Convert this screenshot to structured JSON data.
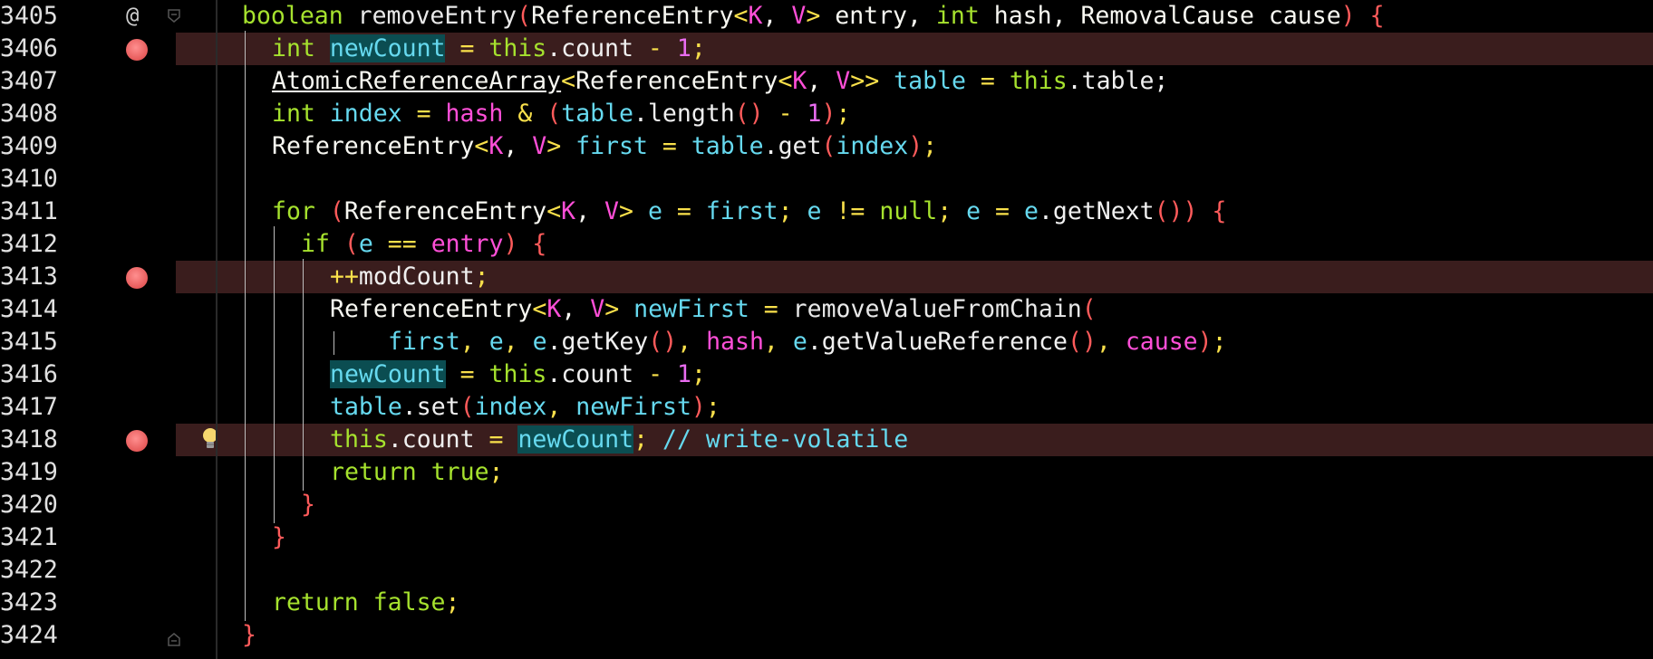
{
  "editor": {
    "lines": [
      {
        "n": "3405"
      },
      {
        "n": "3406"
      },
      {
        "n": "3407"
      },
      {
        "n": "3408"
      },
      {
        "n": "3409"
      },
      {
        "n": "3410"
      },
      {
        "n": "3411"
      },
      {
        "n": "3412"
      },
      {
        "n": "3413"
      },
      {
        "n": "3414"
      },
      {
        "n": "3415"
      },
      {
        "n": "3416"
      },
      {
        "n": "3417"
      },
      {
        "n": "3418"
      },
      {
        "n": "3419"
      },
      {
        "n": "3420"
      },
      {
        "n": "3421"
      },
      {
        "n": "3422"
      },
      {
        "n": "3423"
      },
      {
        "n": "3424"
      }
    ],
    "override_marker": "@",
    "breakpoint_lines": [
      "3406",
      "3413",
      "3418"
    ],
    "intention_bulb_line": "3418",
    "highlighted_symbol": "newCount",
    "colors": {
      "background": "#000000",
      "breakpoint_row": "#3a1d1d",
      "breakpoint_dot": "#e65a5a",
      "symbol_highlight": "#0b4d51",
      "keyword": "#a6e22e",
      "variable": "#66d9ef",
      "operator": "#f9e04b",
      "paren": "#ff5b5b",
      "generic": "#ff4fd8"
    }
  },
  "code": {
    "l3405": {
      "t1": "boolean",
      "t2": " removeEntry",
      "t3": "(",
      "t4": "ReferenceEntry",
      "t5": "<",
      "t6": "K",
      "t7": ", ",
      "t8": "V",
      "t9": ">",
      "t10": " entry, ",
      "t11": "int",
      "t12": " hash, RemovalCause cause",
      "t13": ")",
      "t14": " {"
    },
    "l3406": {
      "t1": "int",
      "t2": " ",
      "t3": "newCount",
      "t4": " ",
      "t5": "=",
      "t6": " ",
      "t7": "this",
      "t8": ".count ",
      "t9": "-",
      "t10": " ",
      "t11": "1",
      "t12": ";"
    },
    "l3407": {
      "t1": "AtomicReferenceArray",
      "t2": "<",
      "t3": "ReferenceEntry",
      "t4": "<",
      "t5": "K",
      "t6": ", ",
      "t7": "V",
      "t8": ">>",
      "t9": " ",
      "t10": "table",
      "t11": " ",
      "t12": "=",
      "t13": " ",
      "t14": "this",
      "t15": ".table;"
    },
    "l3408": {
      "t1": "int",
      "t2": " ",
      "t3": "index",
      "t4": " ",
      "t5": "=",
      "t6": " ",
      "t7": "hash",
      "t8": " ",
      "t9": "&",
      "t10": " ",
      "t11": "(",
      "t12": "table",
      "t13": ".length",
      "t14": "()",
      "t15": " ",
      "t16": "-",
      "t17": " ",
      "t18": "1",
      "t19": ")",
      "t20": ";"
    },
    "l3409": {
      "t1": "ReferenceEntry",
      "t2": "<",
      "t3": "K",
      "t4": ", ",
      "t5": "V",
      "t6": ">",
      "t7": " ",
      "t8": "first",
      "t9": " ",
      "t10": "=",
      "t11": " ",
      "t12": "table",
      "t13": ".get",
      "t14": "(",
      "t15": "index",
      "t16": ")",
      "t17": ";"
    },
    "l3411": {
      "t1": "for",
      "t2": " ",
      "t3": "(",
      "t4": "ReferenceEntry",
      "t5": "<",
      "t6": "K",
      "t7": ", ",
      "t8": "V",
      "t9": ">",
      "t10": " ",
      "t11": "e",
      "t12": " ",
      "t13": "=",
      "t14": " ",
      "t15": "first",
      "t16": "; ",
      "t17": "e",
      "t18": " ",
      "t19": "!=",
      "t20": " ",
      "t21": "null",
      "t22": "; ",
      "t23": "e",
      "t24": " ",
      "t25": "=",
      "t26": " ",
      "t27": "e",
      "t28": ".getNext",
      "t29": "()",
      "t30": ")",
      "t31": " {"
    },
    "l3412": {
      "t1": "if",
      "t2": " ",
      "t3": "(",
      "t4": "e",
      "t5": " ",
      "t6": "==",
      "t7": " ",
      "t8": "entry",
      "t9": ")",
      "t10": " {"
    },
    "l3413": {
      "t1": "++",
      "t2": "modCount",
      "t3": ";"
    },
    "l3414": {
      "t1": "ReferenceEntry",
      "t2": "<",
      "t3": "K",
      "t4": ", ",
      "t5": "V",
      "t6": ">",
      "t7": " ",
      "t8": "newFirst",
      "t9": " ",
      "t10": "=",
      "t11": " removeValueFromChain",
      "t12": "("
    },
    "l3415": {
      "t1": "first",
      "t2": ", ",
      "t3": "e",
      "t4": ", ",
      "t5": "e",
      "t6": ".getKey",
      "t7": "()",
      "t8": ", ",
      "t9": "hash",
      "t10": ", ",
      "t11": "e",
      "t12": ".getValueReference",
      "t13": "()",
      "t14": ", ",
      "t15": "cause",
      "t16": ")",
      "t17": ";"
    },
    "l3416": {
      "t1": "newCount",
      "t2": " ",
      "t3": "=",
      "t4": " ",
      "t5": "this",
      "t6": ".count ",
      "t7": "-",
      "t8": " ",
      "t9": "1",
      "t10": ";"
    },
    "l3417": {
      "t1": "table",
      "t2": ".set",
      "t3": "(",
      "t4": "index",
      "t5": ", ",
      "t6": "newFirst",
      "t7": ")",
      "t8": ";"
    },
    "l3418": {
      "t1": "this",
      "t2": ".count ",
      "t3": "=",
      "t4": " ",
      "t5": "newCount",
      "t6": "; ",
      "t7": "// write-volatile"
    },
    "l3419": {
      "t1": "return",
      "t2": " ",
      "t3": "true",
      "t4": ";"
    },
    "l3420": {
      "t1": "}"
    },
    "l3421": {
      "t1": "}"
    },
    "l3423": {
      "t1": "return",
      "t2": " ",
      "t3": "false",
      "t4": ";"
    },
    "l3424": {
      "t1": "}"
    }
  }
}
